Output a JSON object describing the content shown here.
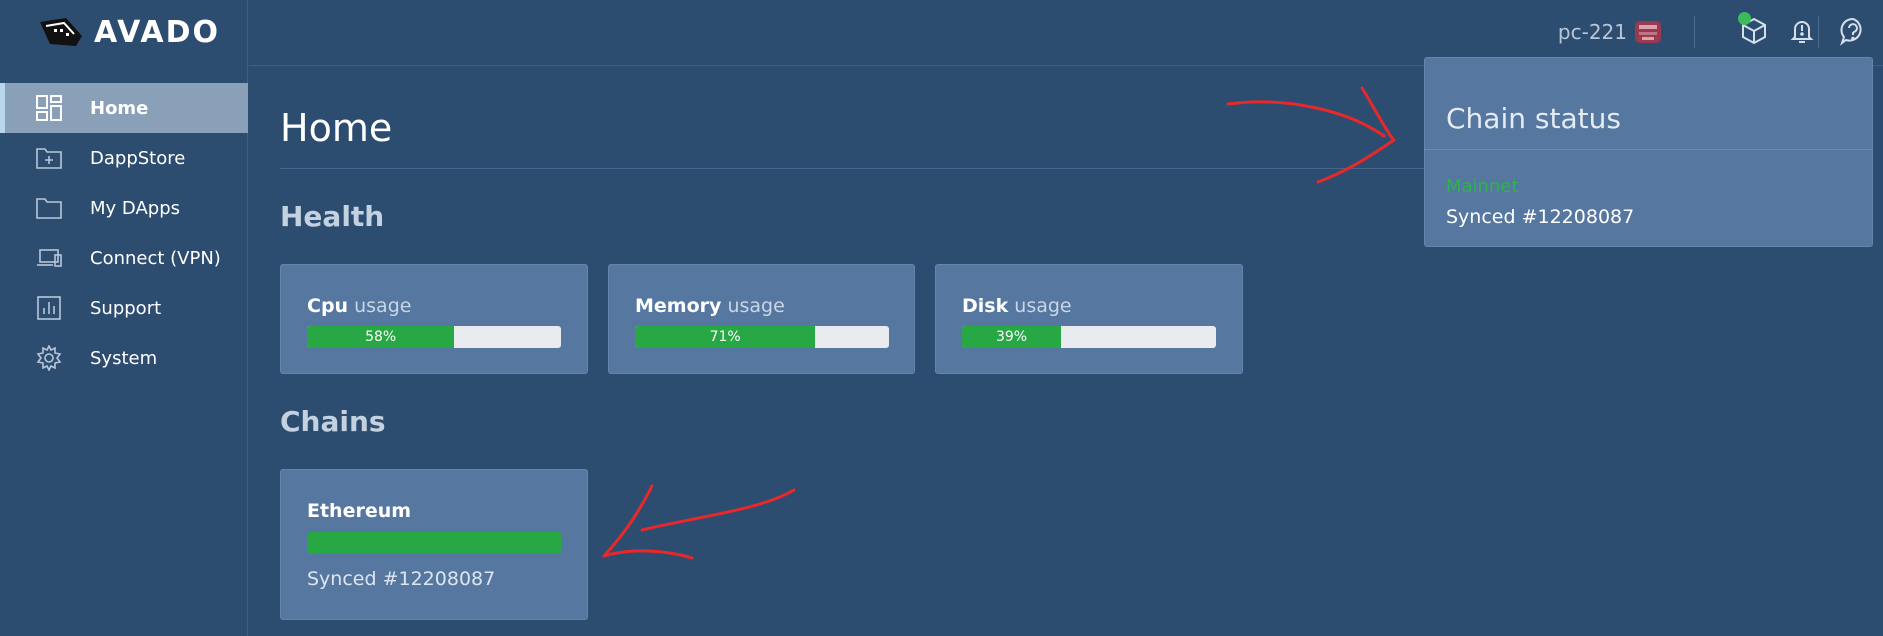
{
  "app": {
    "logo_text": "AVADO"
  },
  "sidebar": {
    "items": [
      {
        "label": "Home",
        "icon": "dashboard-icon"
      },
      {
        "label": "DappStore",
        "icon": "folder-plus-icon"
      },
      {
        "label": "My DApps",
        "icon": "folder-icon"
      },
      {
        "label": "Connect (VPN)",
        "icon": "devices-icon"
      },
      {
        "label": "Support",
        "icon": "chart-icon"
      },
      {
        "label": "System",
        "icon": "gear-icon"
      }
    ],
    "active": "Home"
  },
  "topbar": {
    "user_name": "pc-221",
    "icons": [
      "avatar",
      "package-icon",
      "bell-icon",
      "help-icon"
    ]
  },
  "main": {
    "title": "Home",
    "health": {
      "title": "Health",
      "cards": [
        {
          "name_bold": "Cpu",
          "name_rest": " usage",
          "value_label": "58%",
          "value": 58
        },
        {
          "name_bold": "Memory",
          "name_rest": " usage",
          "value_label": "71%",
          "value": 71
        },
        {
          "name_bold": "Disk",
          "name_rest": " usage",
          "value_label": "39%",
          "value": 39
        }
      ]
    },
    "chains": {
      "title": "Chains",
      "cards": [
        {
          "name": "Ethereum",
          "progress": 100,
          "status": "Synced #12208087"
        }
      ]
    }
  },
  "chain_status": {
    "title": "Chain status",
    "network": "Mainnet",
    "status": "Synced #12208087"
  },
  "colors": {
    "background": "#2d4d70",
    "card": "#5577a0",
    "progress": "#28a745",
    "annotation": "#e8282b"
  }
}
